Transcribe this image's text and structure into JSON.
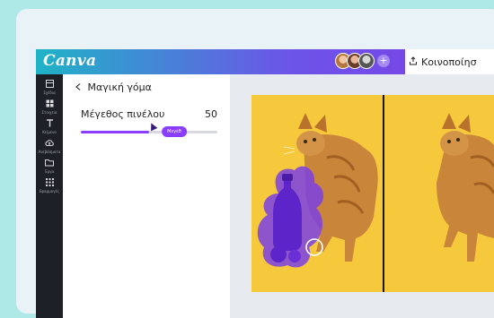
{
  "app": {
    "logo": "Canva"
  },
  "header": {
    "share_label": "Κοινοποίησ",
    "share_icon": "share-upload-icon",
    "add_collaborator_glyph": "+"
  },
  "sidebar": {
    "items": [
      {
        "label": "Σχέδια",
        "icon": "templates-icon"
      },
      {
        "label": "Στοιχεία",
        "icon": "elements-icon"
      },
      {
        "label": "Κείμενο",
        "icon": "text-icon"
      },
      {
        "label": "Ανεβάσματα",
        "icon": "uploads-icon"
      },
      {
        "label": "Έργα",
        "icon": "folder-icon"
      },
      {
        "label": "Εφαρμογές",
        "icon": "apps-icon"
      }
    ]
  },
  "panel": {
    "title": "Μαγική γόμα",
    "brush_size_label": "Μέγεθος πινέλου",
    "brush_size_value": "50",
    "brush_size_fraction": 0.5,
    "slider_tag": "Μεγέθ"
  },
  "colors": {
    "brand_purple": "#8b3dff",
    "brand_teal": "#1fb3c6",
    "photo_background": "#f6c93d",
    "eraser_highlight": "#7b3fe4"
  }
}
